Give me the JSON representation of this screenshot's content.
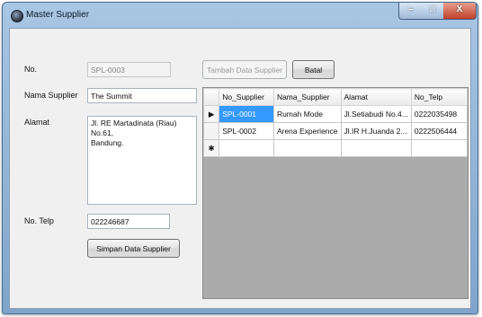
{
  "window": {
    "title": "Master Supplier",
    "minimize_glyph": "–",
    "maximize_glyph": "□",
    "close_glyph": "X"
  },
  "form": {
    "no_label": "No.",
    "no_value": "SPL-0003",
    "nama_label": "Nama Supplier",
    "nama_value": "The Summit",
    "alamat_label": "Alamat",
    "alamat_value": "Jl. RE Martadinata (Riau) No.61,\nBandung.",
    "telp_label": "No. Telp",
    "telp_value": "022246687",
    "save_button": "Simpan Data Supplier",
    "add_button": "Tambah Data Supplier",
    "cancel_button": "Batal"
  },
  "grid": {
    "columns": [
      "No_Supplier",
      "Nama_Supplier",
      "Alamat",
      "No_Telp"
    ],
    "rows": [
      {
        "indicator": "▶",
        "cells": [
          "SPL-0001",
          "Rumah Mode",
          "Jl.Setiabudi No.4...",
          "0222035498"
        ]
      },
      {
        "indicator": "",
        "cells": [
          "SPL-0002",
          "Arena Experience",
          "Jl.IR H.Juanda 2...",
          "0222506444"
        ]
      },
      {
        "indicator": "✱",
        "cells": [
          "",
          "",
          "",
          ""
        ]
      }
    ]
  }
}
